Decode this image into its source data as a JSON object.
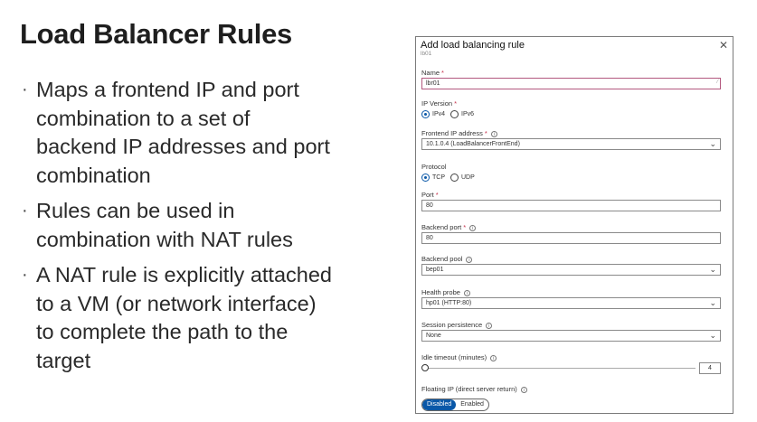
{
  "slide": {
    "title": "Load Balancer Rules",
    "bullets": [
      "Maps a frontend IP and port\ncombination to a set of\nbackend IP addresses and port\ncombination",
      "Rules can be used in\ncombination with NAT rules",
      "A NAT rule is explicitly attached\nto a VM (or network interface)\nto complete the path to the\ntarget"
    ]
  },
  "panel": {
    "title": "Add load balancing rule",
    "subtitle": "lb01",
    "close_icon": "close-icon",
    "name": {
      "label": "Name",
      "required": "*",
      "value": "lbr01"
    },
    "ip_version": {
      "label": "IP Version",
      "required": "*",
      "options": [
        "IPv4",
        "IPv6"
      ],
      "selected": "IPv4"
    },
    "frontend_ip": {
      "label": "Frontend IP address",
      "required": "*",
      "value": "10.1.0.4 (LoadBalancerFrontEnd)"
    },
    "protocol": {
      "label": "Protocol",
      "options": [
        "TCP",
        "UDP"
      ],
      "selected": "TCP"
    },
    "port": {
      "label": "Port",
      "required": "*",
      "value": "80"
    },
    "backend_port": {
      "label": "Backend port",
      "required": "*",
      "value": "80"
    },
    "backend_pool": {
      "label": "Backend pool",
      "value": "bep01"
    },
    "health_probe": {
      "label": "Health probe",
      "value": "hp01 (HTTP:80)"
    },
    "session_persistence": {
      "label": "Session persistence",
      "value": "None"
    },
    "idle_timeout": {
      "label": "Idle timeout (minutes)",
      "value": "4"
    },
    "floating_ip": {
      "label": "Floating IP (direct server return)",
      "options": [
        "Disabled",
        "Enabled"
      ],
      "selected": "Disabled"
    }
  },
  "colors": {
    "accent": "#0a58a8",
    "required": "#c4314b",
    "border": "#8a8a8a"
  }
}
